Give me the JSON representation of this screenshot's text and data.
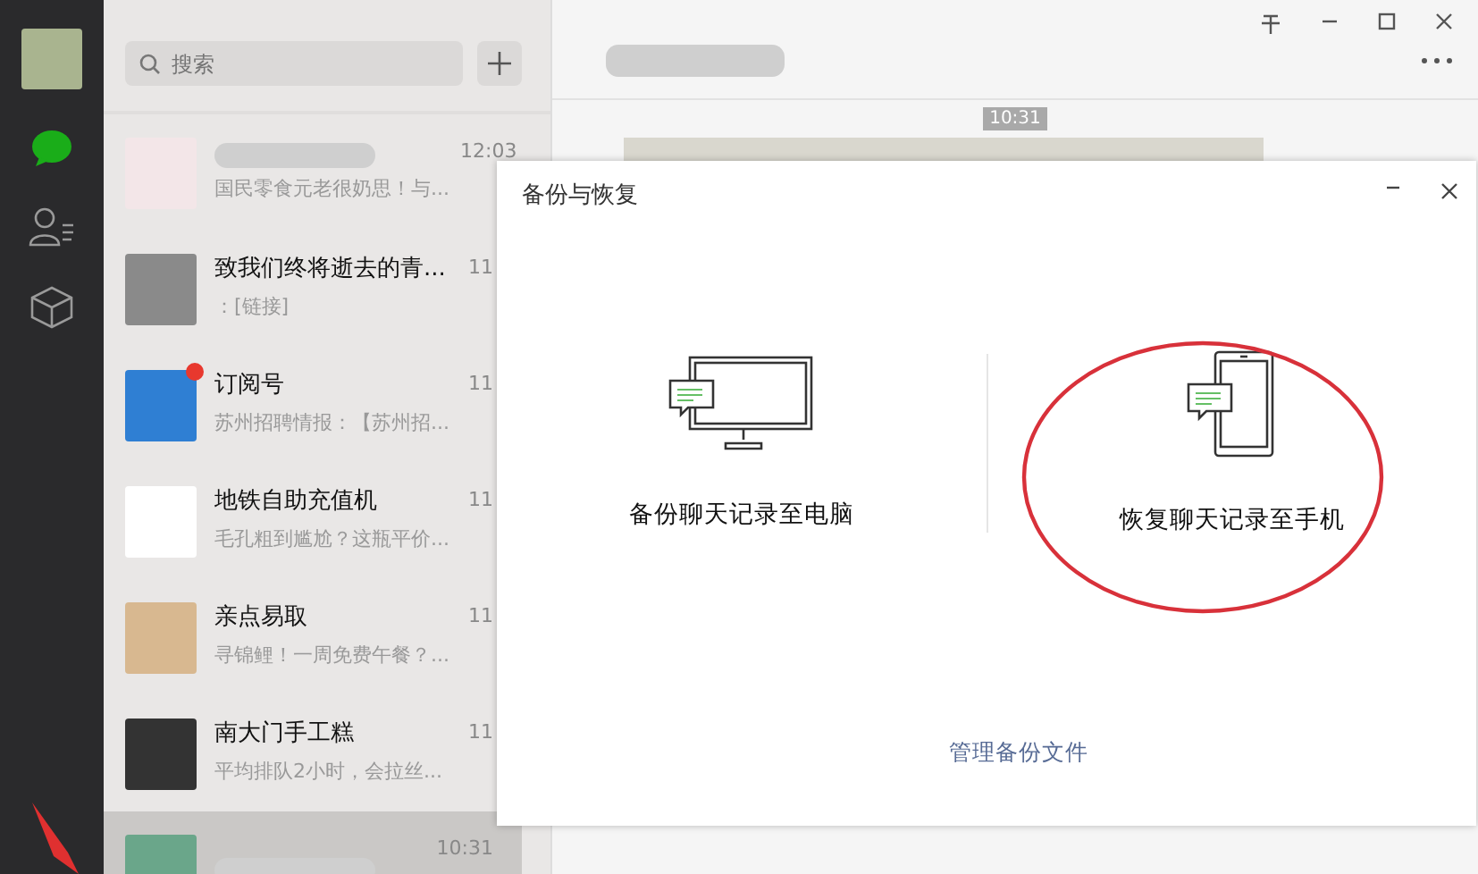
{
  "search": {
    "placeholder": "搜索"
  },
  "chats": [
    {
      "preview": "国民零食元老很奶思！与...",
      "time": "12:03",
      "unread": false,
      "selected": false
    },
    {
      "name": "致我们终将逝去的青...",
      "preview": "：[链接]",
      "time": "11",
      "unread": false,
      "selected": false
    },
    {
      "name": "订阅号",
      "preview": "苏州招聘情报：【苏州招...",
      "time": "11",
      "unread": true,
      "selected": false
    },
    {
      "name": "地铁自助充值机",
      "preview": "毛孔粗到尴尬？这瓶平价...",
      "time": "11",
      "unread": false,
      "selected": false
    },
    {
      "name": "亲点易取",
      "preview": "寻锦鲤！一周免费午餐？...",
      "time": "11",
      "unread": false,
      "selected": false
    },
    {
      "name": "南大门手工糕",
      "preview": "平均排队2小时，会拉丝...",
      "time": "11",
      "unread": false,
      "selected": false
    },
    {
      "time": "10:31",
      "unread": false,
      "selected": true
    }
  ],
  "conversation": {
    "time": "10:31"
  },
  "dialog": {
    "title": "备份与恢复",
    "options": [
      {
        "kind": "computer",
        "label": "备份聊天记录至电脑"
      },
      {
        "kind": "phone",
        "label": "恢复聊天记录至手机"
      }
    ],
    "link": "管理备份文件"
  }
}
